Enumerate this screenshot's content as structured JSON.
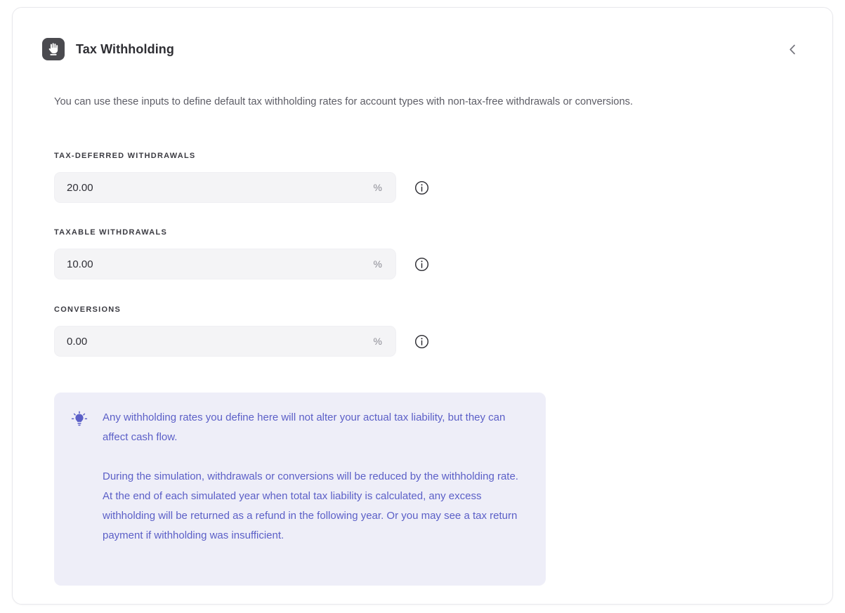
{
  "card": {
    "icon_name": "hand-palm-icon",
    "title": "Tax Withholding",
    "collapse_icon": "chevron-left-icon",
    "description": "You can use these inputs to define default tax withholding rates for account types with non-tax-free withdrawals or conversions."
  },
  "fields": [
    {
      "label": "TAX-DEFERRED WITHDRAWALS",
      "value": "20.00",
      "placeholder": "0.00",
      "suffix": "%",
      "info_icon": "info-circle-icon"
    },
    {
      "label": "TAXABLE WITHDRAWALS",
      "value": "10.00",
      "placeholder": "0.00",
      "suffix": "%",
      "info_icon": "info-circle-icon"
    },
    {
      "label": "CONVERSIONS",
      "value": "0.00",
      "placeholder": "0.00",
      "suffix": "%",
      "info_icon": "info-circle-icon"
    }
  ],
  "callout": {
    "icon_name": "lightbulb-icon",
    "paragraph_1": "Any withholding rates you define here will not alter your actual tax liability, but they can affect cash flow.",
    "paragraph_2": "During the simulation, withdrawals or conversions will be reduced by the withholding rate. At the end of each simulated year when total tax liability is calculated, any excess withholding will be returned as a refund in the following year. Or you may see a tax return payment if withholding was insufficient."
  },
  "colors": {
    "accent": "#5b5fc7",
    "callout_bg": "#eeeef8",
    "icon_bg": "#4a4a4f",
    "input_bg": "#f4f4f6",
    "text_primary": "#2e2e33",
    "text_secondary": "#5d5d66"
  }
}
